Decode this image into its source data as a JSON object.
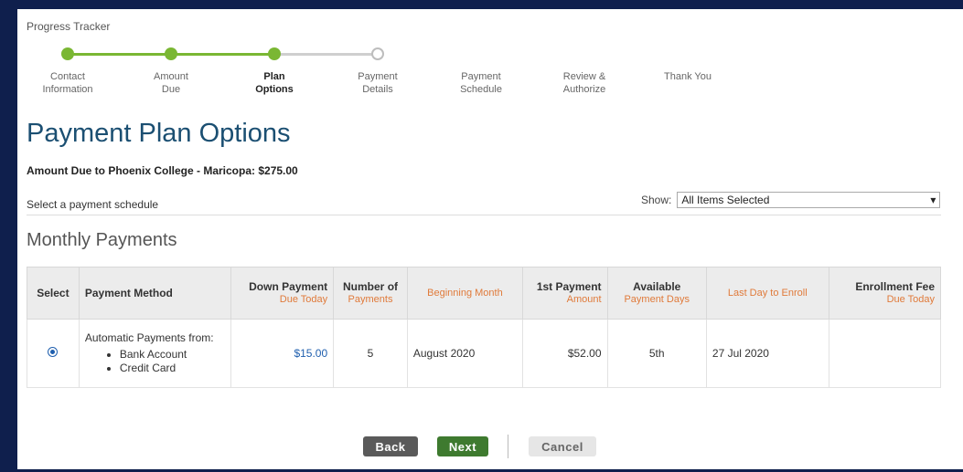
{
  "tracker": {
    "title": "Progress Tracker",
    "steps": [
      {
        "label_line1": "Contact",
        "label_line2": "Information"
      },
      {
        "label_line1": "Amount",
        "label_line2": "Due"
      },
      {
        "label_line1": "Plan",
        "label_line2": "Options"
      },
      {
        "label_line1": "Payment",
        "label_line2": "Details"
      },
      {
        "label_line1": "Payment",
        "label_line2": "Schedule"
      },
      {
        "label_line1": "Review &",
        "label_line2": "Authorize"
      },
      {
        "label_line1": "Thank You",
        "label_line2": ""
      }
    ]
  },
  "page": {
    "title": "Payment Plan Options",
    "amount_due": "Amount Due to Phoenix College - Maricopa: $275.00",
    "select_schedule": "Select a payment schedule",
    "show_label": "Show:",
    "show_value": "All Items Selected",
    "section_title": "Monthly Payments"
  },
  "table": {
    "headers": {
      "select": "Select",
      "method": "Payment Method",
      "down_payment": "Down Payment",
      "down_payment_sub": "Due Today",
      "number_of": "Number of",
      "number_of_sub": "Payments",
      "beginning_month": "Beginning Month",
      "first_payment": "1st Payment",
      "first_payment_sub": "Amount",
      "available": "Available",
      "available_sub": "Payment Days",
      "last_day": "Last Day to Enroll",
      "enrollment_fee": "Enrollment Fee",
      "enrollment_fee_sub": "Due Today"
    },
    "rows": [
      {
        "method_title": "Automatic Payments from:",
        "methods": [
          "Bank Account",
          "Credit Card"
        ],
        "down_payment": "$15.00",
        "number_of": "5",
        "beginning_month": "August 2020",
        "first_payment": "$52.00",
        "available": "5th",
        "last_day": "27 Jul 2020",
        "enrollment_fee": ""
      }
    ]
  },
  "buttons": {
    "back": "Back",
    "next": "Next",
    "cancel": "Cancel"
  },
  "colors": {
    "progress_green": "#7ab733",
    "title_blue": "#1b4f72",
    "next_green": "#3e7a2f",
    "back_grey": "#5a5a5a"
  }
}
